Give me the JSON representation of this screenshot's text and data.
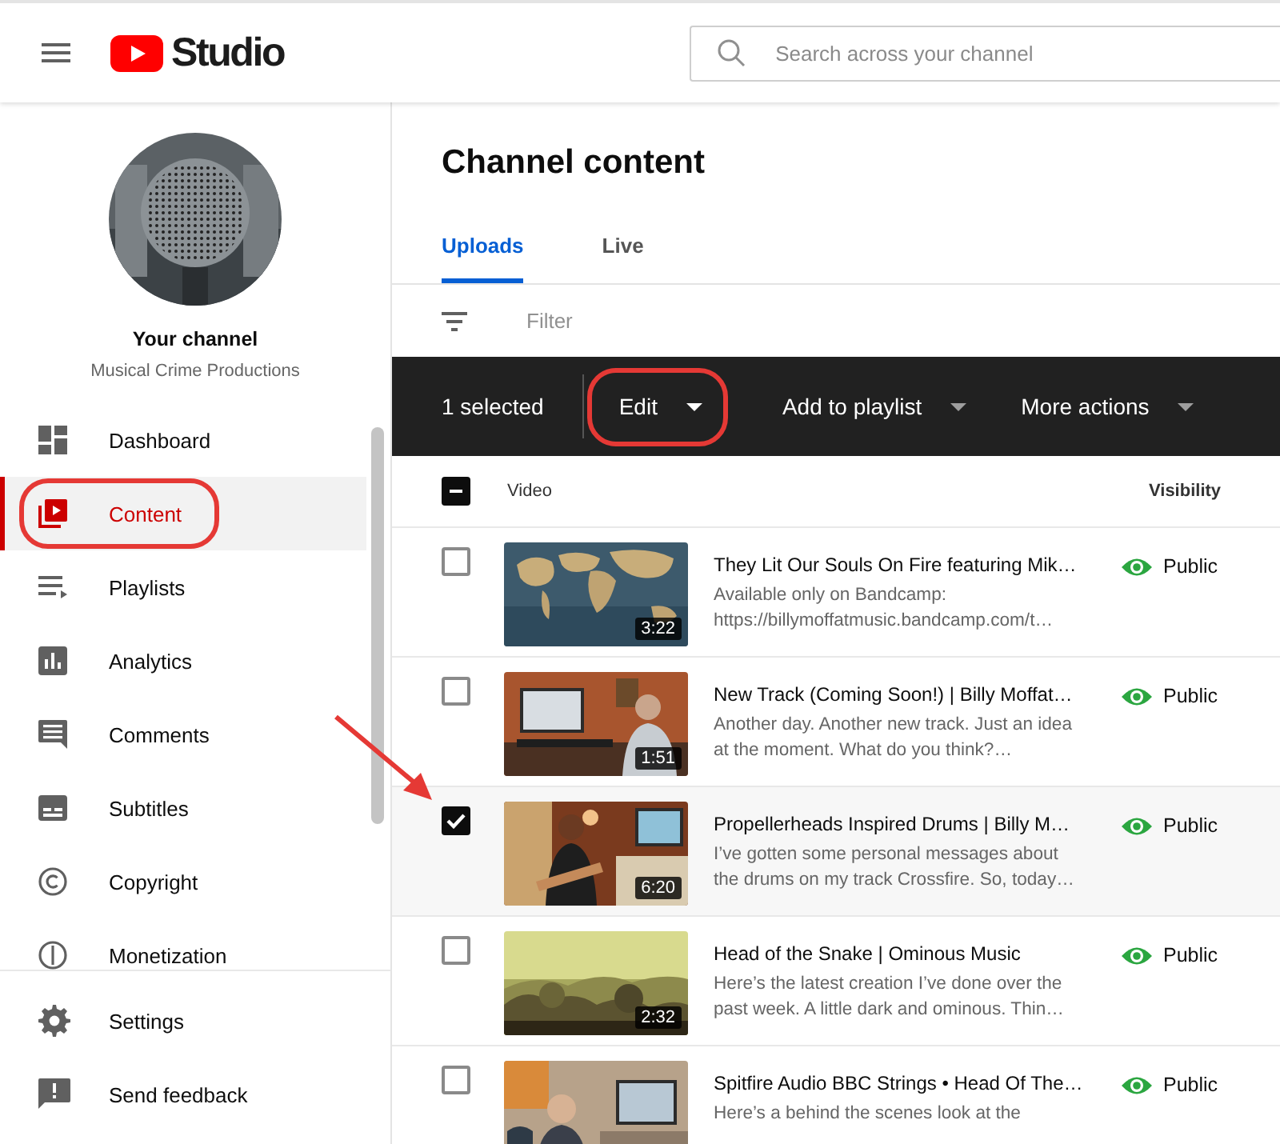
{
  "header": {
    "logo_text": "Studio",
    "search": {
      "placeholder": "Search across your channel"
    }
  },
  "channel": {
    "name": "Your channel",
    "subtitle": "Musical Crime Productions"
  },
  "sidebar": {
    "items": [
      {
        "label": "Dashboard",
        "selected": false,
        "highlighted": false
      },
      {
        "label": "Content",
        "selected": true,
        "highlighted": true
      },
      {
        "label": "Playlists",
        "selected": false,
        "highlighted": false
      },
      {
        "label": "Analytics",
        "selected": false,
        "highlighted": false
      },
      {
        "label": "Comments",
        "selected": false,
        "highlighted": false
      },
      {
        "label": "Subtitles",
        "selected": false,
        "highlighted": false
      },
      {
        "label": "Copyright",
        "selected": false,
        "highlighted": false
      },
      {
        "label": "Monetization",
        "selected": false,
        "highlighted": false
      }
    ],
    "footer_items": [
      {
        "label": "Settings"
      },
      {
        "label": "Send feedback"
      }
    ]
  },
  "page": {
    "title": "Channel content",
    "tabs": [
      {
        "label": "Uploads",
        "selected": true
      },
      {
        "label": "Live",
        "selected": false
      }
    ],
    "filter": {
      "placeholder": "Filter"
    }
  },
  "selection_bar": {
    "count": "1 selected",
    "actions": [
      {
        "label": "Edit",
        "highlighted": true
      },
      {
        "label": "Add to playlist",
        "highlighted": false
      },
      {
        "label": "More actions",
        "highlighted": false
      }
    ]
  },
  "table": {
    "columns": [
      "Video",
      "Visibility"
    ],
    "select_all": {
      "indeterminate": true
    },
    "row_pointer": true,
    "rows": [
      {
        "title": "They Lit Our Souls On Fire featuring Mik…",
        "description": "Available only on Bandcamp: https://billymoffatmusic.bandcamp.com/t…",
        "duration": "3:22",
        "visibility": "Public",
        "checked": false
      },
      {
        "title": "New Track (Coming Soon!) | Billy Moffat…",
        "description": "Another day. Another new track. Just an idea at the moment. What do you think?…",
        "duration": "1:51",
        "visibility": "Public",
        "checked": false
      },
      {
        "title": "Propellerheads Inspired Drums | Billy M…",
        "description": "I’ve gotten some personal messages about the drums on my track Crossfire. So, today…",
        "duration": "6:20",
        "visibility": "Public",
        "checked": true
      },
      {
        "title": "Head of the Snake | Ominous Music",
        "description": "Here’s the latest creation I’ve done over the past week. A little dark and ominous. Thin…",
        "duration": "2:32",
        "visibility": "Public",
        "checked": false
      },
      {
        "title": "Spitfire Audio BBC Strings • Head Of The…",
        "description": "Here’s a behind the scenes look at the",
        "visibility": "Public",
        "checked": false
      }
    ]
  }
}
